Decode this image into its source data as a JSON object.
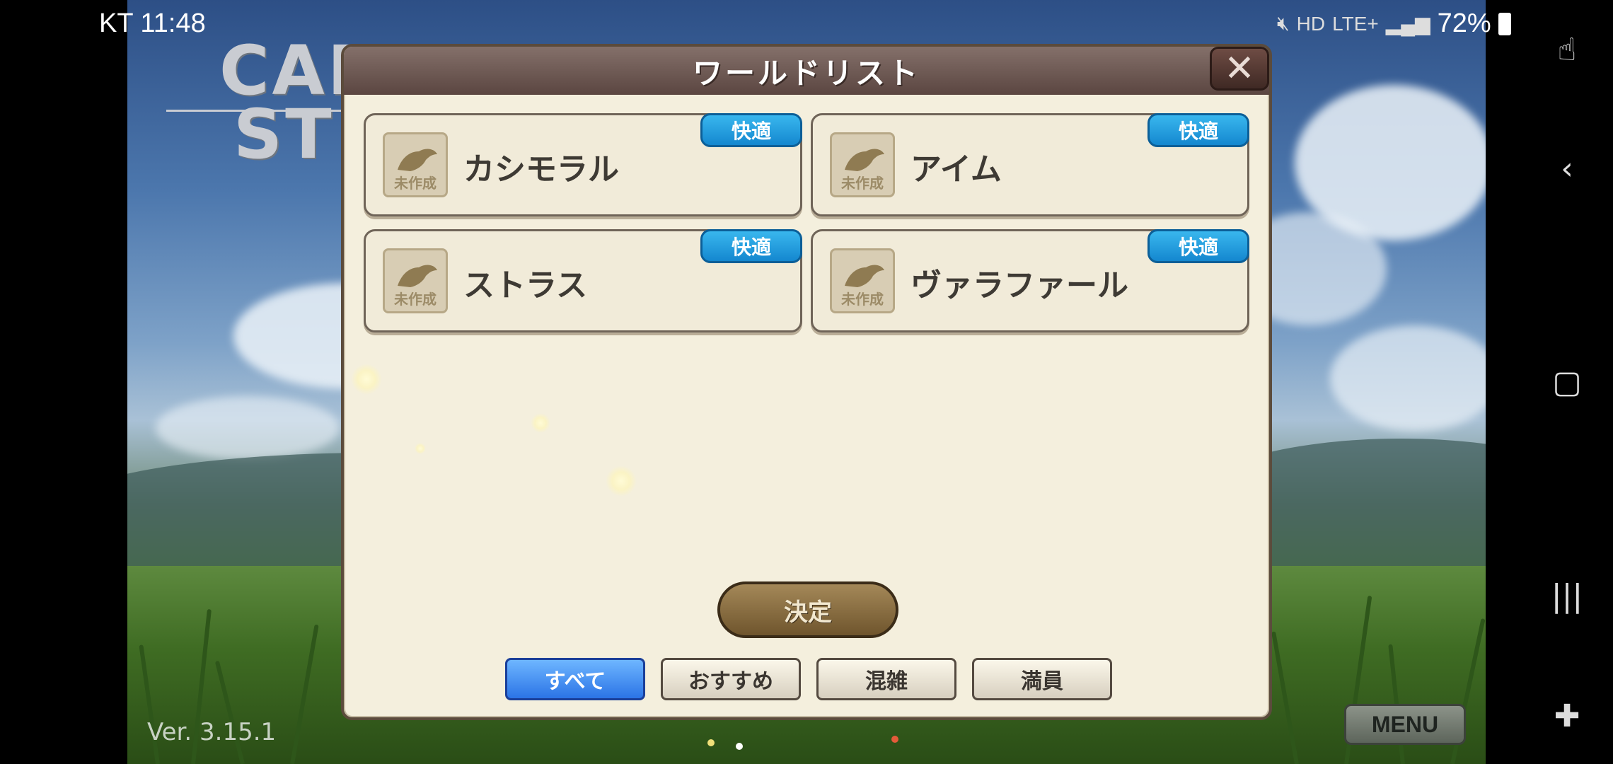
{
  "status_bar": {
    "carrier_time": "KT 11:48",
    "network": "LTE+",
    "battery": "72%"
  },
  "game": {
    "logo_text_line1": "CAR",
    "logo_text_line2": "ST",
    "version": "Ver. 3.15.1",
    "menu_label": "MENU"
  },
  "dialog": {
    "title": "ワールドリスト",
    "close_glyph": "✕",
    "worlds": [
      {
        "name": "カシモラル",
        "icon_label": "未作成",
        "status": "快適"
      },
      {
        "name": "アイム",
        "icon_label": "未作成",
        "status": "快適"
      },
      {
        "name": "ストラス",
        "icon_label": "未作成",
        "status": "快適"
      },
      {
        "name": "ヴァラファール",
        "icon_label": "未作成",
        "status": "快適"
      }
    ],
    "decide_label": "決定",
    "filters": [
      {
        "label": "すべて",
        "active": true
      },
      {
        "label": "おすすめ",
        "active": false
      },
      {
        "label": "混雑",
        "active": false
      },
      {
        "label": "満員",
        "active": false
      }
    ]
  },
  "colors": {
    "badge_blue": "#1487cf",
    "active_filter": "#2b74e6",
    "dialog_bg": "#f4efdd",
    "header_brown": "#5b4641"
  },
  "icons": {
    "world_icon": "dinosaur-icon",
    "nav": [
      "touch-lock-icon",
      "back-icon",
      "home-icon",
      "recents-icon",
      "gamepad-icon"
    ]
  }
}
